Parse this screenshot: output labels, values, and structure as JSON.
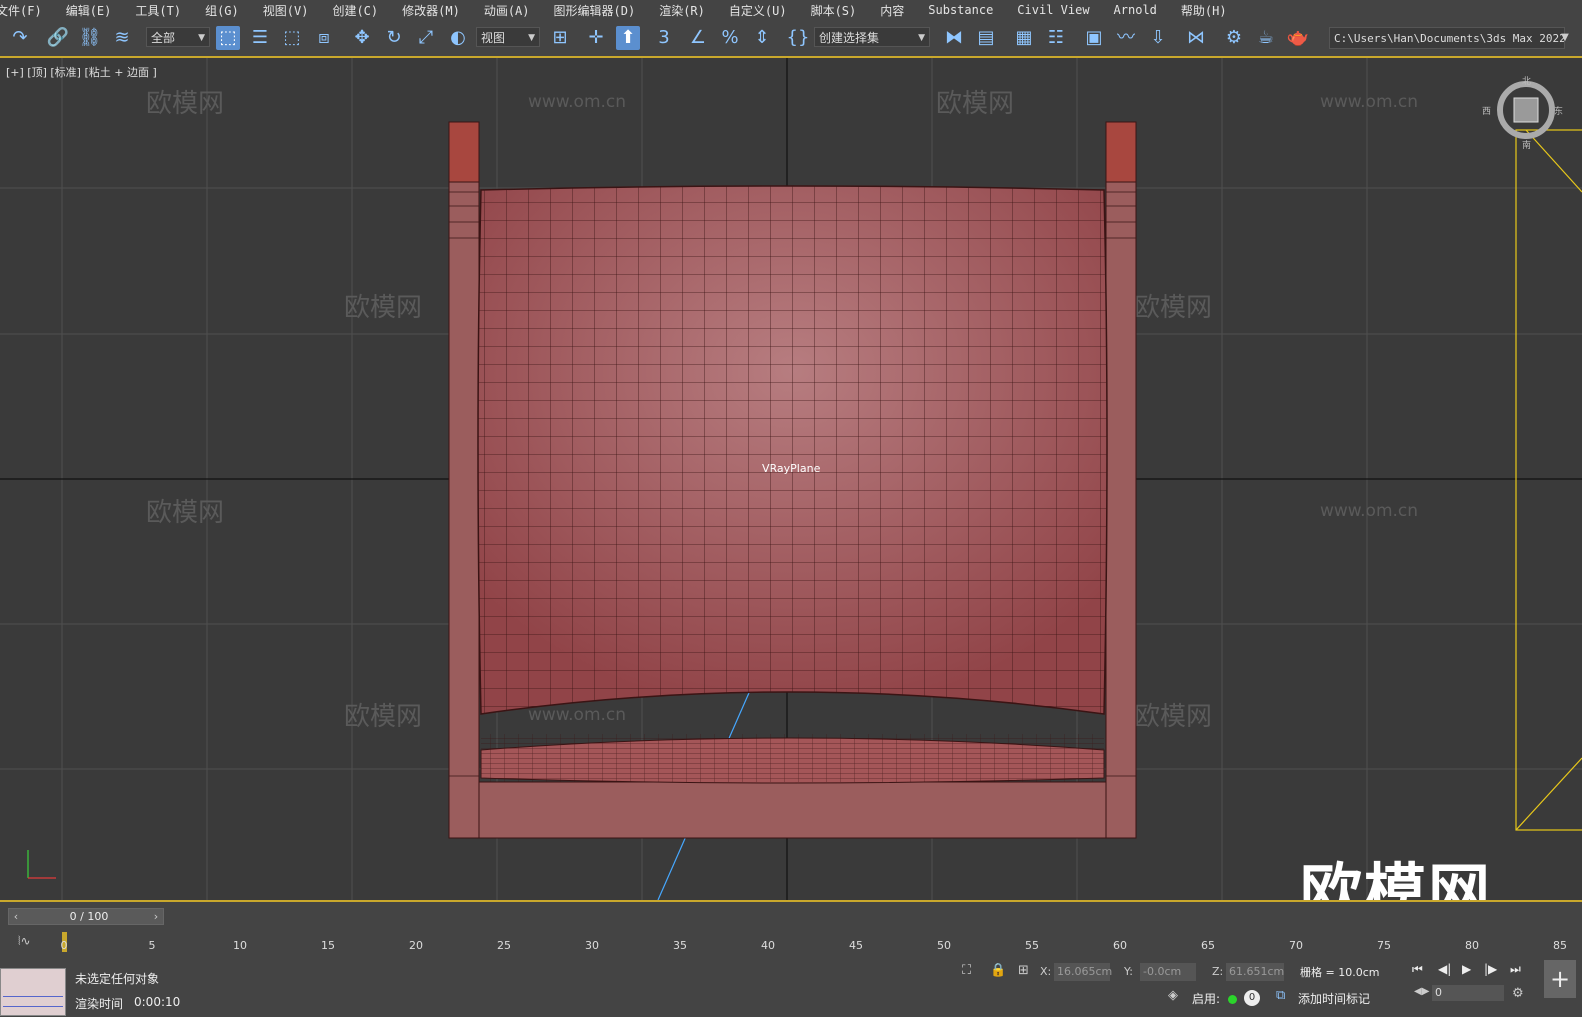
{
  "menu": [
    "文件(F)",
    "编辑(E)",
    "工具(T)",
    "组(G)",
    "视图(V)",
    "创建(C)",
    "修改器(M)",
    "动画(A)",
    "图形编辑器(D)",
    "渲染(R)",
    "自定义(U)",
    "脚本(S)",
    "内容",
    "Substance",
    "Civil View",
    "Arnold",
    "帮助(H)"
  ],
  "toolbar": {
    "selection_filter": "全部",
    "ref_coord": "视图",
    "named_selection": "创建选择集",
    "snap_label": "3",
    "project_path": "C:\\Users\\Han\\Documents\\3ds Max 2022"
  },
  "viewport": {
    "label": "[+] [顶] [标准] [粘土 + 边面 ]",
    "object_label": "VRayPlane",
    "viewcube_labels": {
      "north": "北",
      "west": "西",
      "east": "东",
      "south": "南"
    },
    "watermark_text": "欧模网",
    "watermark_url": "www.om.cn",
    "accent_colors": {
      "object": "#9b5d5d",
      "wire": "#3a1414",
      "selection": "#e8c81a",
      "grid": "#505050"
    }
  },
  "timeline": {
    "slider_value": "0 / 100",
    "ticks": [
      "0",
      "5",
      "10",
      "15",
      "20",
      "25",
      "30",
      "35",
      "40",
      "45",
      "50",
      "55",
      "60",
      "65",
      "70",
      "75",
      "80",
      "85"
    ]
  },
  "status": {
    "selection": "未选定任何对象",
    "render_time_label": "渲染时间",
    "render_time_value": "0:00:10",
    "x_label": "X:",
    "x_value": "16.065cm",
    "y_label": "Y:",
    "y_value": "-0.0cm",
    "z_label": "Z:",
    "z_value": "61.651cm",
    "grid": "栅格 = 10.0cm",
    "enable_label": "启用:",
    "enable_count": "0",
    "add_time_tag": "添加时间标记",
    "frame_value": "0"
  }
}
